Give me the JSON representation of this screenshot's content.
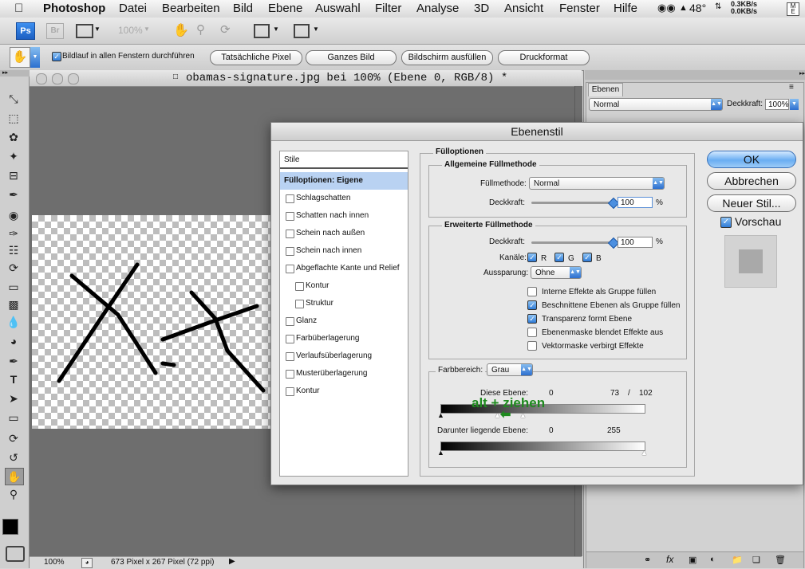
{
  "menubar": {
    "app": "Photoshop",
    "items": [
      "Datei",
      "Bearbeiten",
      "Bild",
      "Ebene",
      "Auswahl",
      "Filter",
      "Analyse",
      "3D",
      "Ansicht",
      "Fenster",
      "Hilfe"
    ],
    "temp": "48°",
    "net_up": "0.3KB/s",
    "net_down": "0.0KB/s"
  },
  "appbar": {
    "ps": "Ps",
    "br": "Br",
    "zoom": "100%"
  },
  "optbar": {
    "scroll_all_label": "Bildlauf in allen Fenstern durchführen",
    "buttons": [
      "Tatsächliche Pixel",
      "Ganzes Bild",
      "Bildschirm ausfüllen",
      "Druckformat"
    ]
  },
  "document": {
    "title": "obamas-signature.jpg bei 100% (Ebene 0, RGB/8) *",
    "status_zoom": "100%",
    "status_info": "673 Pixel x 267 Pixel (72 ppi)"
  },
  "layers_panel": {
    "tab": "Ebenen",
    "blend": "Normal",
    "opacity_label": "Deckkraft:",
    "opacity": "100%"
  },
  "dialog": {
    "title": "Ebenenstil",
    "styles_header": "Stile",
    "styles": [
      {
        "label": "Fülloptionen: Eigene",
        "selected": true,
        "checkbox": false,
        "indent": false
      },
      {
        "label": "Schlagschatten",
        "selected": false,
        "checkbox": true,
        "indent": false
      },
      {
        "label": "Schatten nach innen",
        "selected": false,
        "checkbox": true,
        "indent": false
      },
      {
        "label": "Schein nach außen",
        "selected": false,
        "checkbox": true,
        "indent": false
      },
      {
        "label": "Schein nach innen",
        "selected": false,
        "checkbox": true,
        "indent": false
      },
      {
        "label": "Abgeflachte Kante und Relief",
        "selected": false,
        "checkbox": true,
        "indent": false
      },
      {
        "label": "Kontur",
        "selected": false,
        "checkbox": true,
        "indent": true
      },
      {
        "label": "Struktur",
        "selected": false,
        "checkbox": true,
        "indent": true
      },
      {
        "label": "Glanz",
        "selected": false,
        "checkbox": true,
        "indent": false
      },
      {
        "label": "Farbüberlagerung",
        "selected": false,
        "checkbox": true,
        "indent": false
      },
      {
        "label": "Verlaufsüberlagerung",
        "selected": false,
        "checkbox": true,
        "indent": false
      },
      {
        "label": "Musterüberlagerung",
        "selected": false,
        "checkbox": true,
        "indent": false
      },
      {
        "label": "Kontur",
        "selected": false,
        "checkbox": true,
        "indent": false
      }
    ],
    "fill_options": "Fülloptionen",
    "general_title": "Allgemeine Füllmethode",
    "fill_method_label": "Füllmethode:",
    "fill_method": "Normal",
    "opacity_label": "Deckkraft:",
    "opacity": "100",
    "percent": "%",
    "advanced_title": "Erweiterte Füllmethode",
    "adv_opacity": "100",
    "channels_label": "Kanäle:",
    "channels": [
      "R",
      "G",
      "B"
    ],
    "knockout_label": "Aussparung:",
    "knockout": "Ohne",
    "options": [
      {
        "label": "Interne Effekte als Gruppe füllen",
        "checked": false
      },
      {
        "label": "Beschnittene Ebenen als Gruppe füllen",
        "checked": true
      },
      {
        "label": "Transparenz formt Ebene",
        "checked": true
      },
      {
        "label": "Ebenenmaske blendet Effekte aus",
        "checked": false
      },
      {
        "label": "Vektormaske verbirgt Effekte",
        "checked": false
      }
    ],
    "blend_if_label": "Farbbereich:",
    "blend_if": "Grau",
    "this_layer_label": "Diese Ebene:",
    "this_layer_min": "0",
    "this_layer_max": "73",
    "this_layer_slash": "/",
    "this_layer_max2": "102",
    "under_layer_label": "Darunter liegende Ebene:",
    "under_min": "0",
    "under_max": "255",
    "annotation": "alt + ziehen",
    "ok": "OK",
    "cancel": "Abbrechen",
    "new_style": "Neuer Stil...",
    "preview": "Vorschau"
  },
  "colors": {
    "accent": "#3f8ae0",
    "annotation": "#1f8a1f"
  }
}
